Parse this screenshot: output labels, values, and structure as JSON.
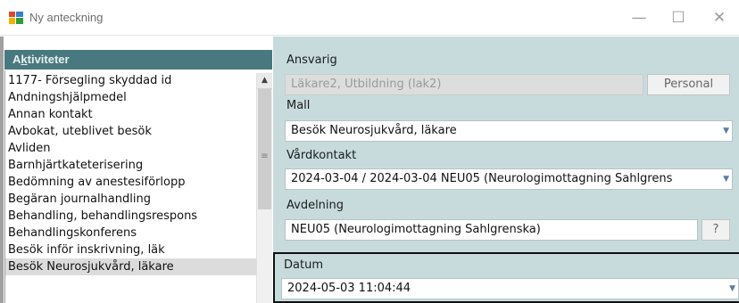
{
  "window": {
    "title": "Ny anteckning",
    "minimize": "—",
    "maximize": "☐",
    "close": "✕"
  },
  "activities": {
    "header_prefix": "A",
    "header_underlined": "k",
    "header_rest": "tiviteter",
    "items": [
      "1177- Försegling skyddad id",
      "Andningshjälpmedel",
      "Annan kontakt",
      "Avbokat, uteblivet besök",
      "Avliden",
      "Barnhjärtkateterisering",
      "Bedömning av anestesiförlopp",
      "Begäran journalhandling",
      "Behandling, behandlingsrespons",
      "Behandlingskonferens",
      "Besök inför inskrivning, läk",
      "Besök Neurosjukvård, läkare"
    ],
    "selected_index": 11
  },
  "form": {
    "ansvarig_label": "Ansvarig",
    "ansvarig_value": "Läkare2, Utbildning (lak2)",
    "personal_button": "Personal",
    "mall_label": "Mall",
    "mall_value": "Besök Neurosjukvård, läkare",
    "vardkontakt_label": "Vårdkontakt",
    "vardkontakt_value": "2024-03-04 / 2024-03-04 NEU05 (Neurologimottagning Sahlgrens",
    "avdelning_label": "Avdelning",
    "avdelning_value": "NEU05 (Neurologimottagning Sahlgrenska)",
    "help_button": "?",
    "datum_label": "Datum",
    "datum_value": "2024-05-03 11:04:44"
  },
  "colors": {
    "header_bg": "#48797e",
    "panel_bg": "#c7dbdd"
  }
}
